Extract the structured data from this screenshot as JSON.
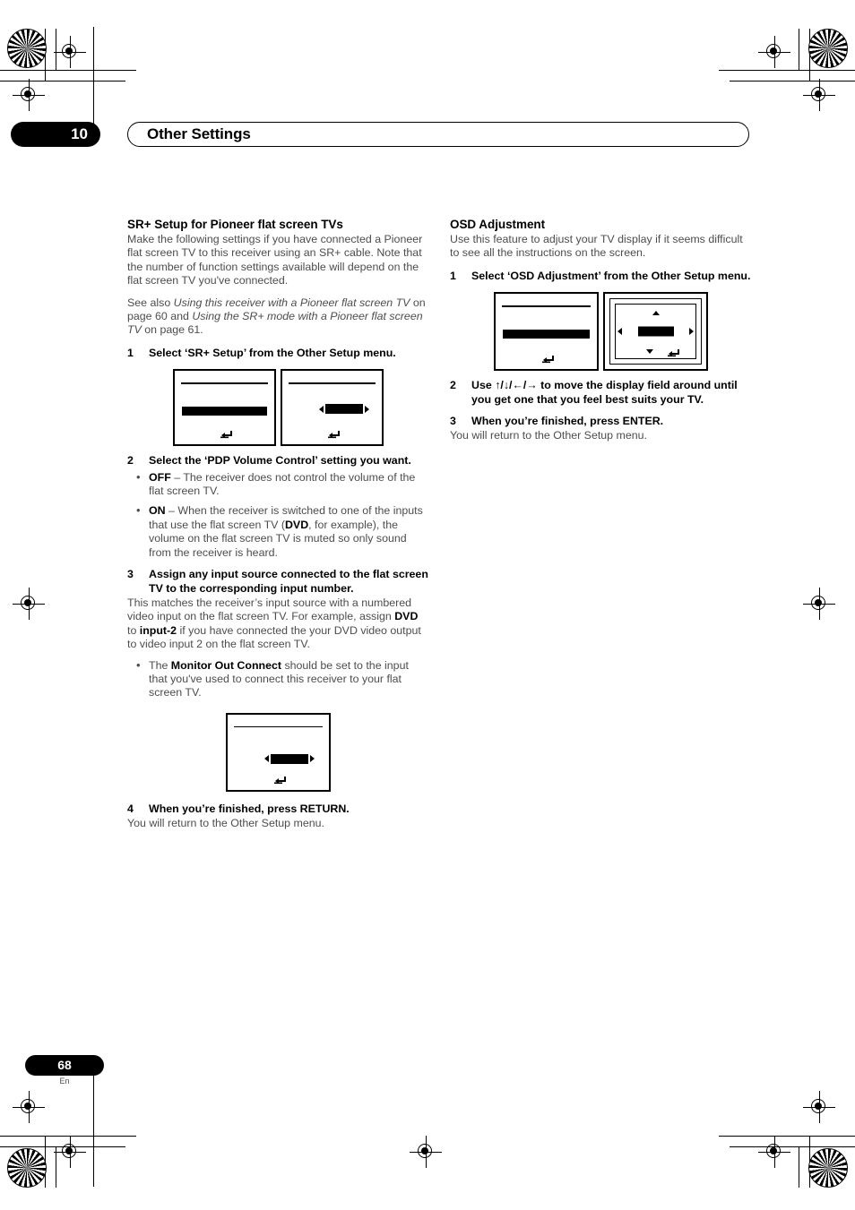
{
  "header": {
    "chapter_number": "10",
    "chapter_title": "Other Settings"
  },
  "left_column": {
    "section_title": "SR+ Setup for Pioneer flat screen TVs",
    "intro_p1": "Make the following settings if you have connected a Pioneer flat screen TV to this receiver using an SR+ cable. Note that the number of function settings available will depend on the flat screen TV you've connected.",
    "intro_p2_prefix": "See also ",
    "intro_p2_italic1": "Using this receiver with a Pioneer flat screen TV",
    "intro_p2_mid": " on page 60 and ",
    "intro_p2_italic2": "Using the SR+ mode with a Pioneer flat screen TV",
    "intro_p2_suffix": " on page 61.",
    "step1_num": "1",
    "step1_text": "Select ‘SR+ Setup’ from the Other Setup menu.",
    "step2_num": "2",
    "step2_text": "Select the ‘PDP Volume Control’ setting you want.",
    "bullet_off_label": "OFF",
    "bullet_off_text": " – The receiver does not control the volume of the flat screen TV.",
    "bullet_on_label": "ON",
    "bullet_on_text_a": " – When the receiver is switched to one of the inputs that use the flat screen TV (",
    "bullet_on_bold_dvd": "DVD",
    "bullet_on_text_b": ", for example), the volume on the flat screen TV is muted so only sound from the receiver is heard.",
    "step3_num": "3",
    "step3_text": "Assign any input source connected to the flat screen TV to the corresponding input number.",
    "step3_body_a": "This matches the receiver’s input source with a numbered video input on the flat screen TV. For example, assign ",
    "step3_bold_dvd": "DVD",
    "step3_body_b": " to ",
    "step3_bold_input2": "input-2",
    "step3_body_c": " if you have connected the your DVD video output to video input 2 on the flat screen TV.",
    "bullet_monitor_a": "The ",
    "bullet_monitor_bold": "Monitor Out Connect",
    "bullet_monitor_b": " should be set to the input that you've used to connect this receiver to your flat screen TV.",
    "step4_num": "4",
    "step4_text": "When you’re finished, press RETURN.",
    "step4_body": "You will return to the Other Setup menu."
  },
  "right_column": {
    "section_title": "OSD Adjustment",
    "intro": "Use this feature to adjust your TV display if it seems difficult to see all the instructions on the screen.",
    "step1_num": "1",
    "step1_text": "Select ‘OSD Adjustment’ from the Other Setup menu.",
    "step2_num": "2",
    "step2_text_a": "Use ",
    "step2_arrows": "↑/↓/←/→",
    "step2_text_b": " to move the display field around until you get one that you feel best suits your TV.",
    "step3_num": "3",
    "step3_text": "When you’re finished, press ENTER.",
    "step3_body": "You will return to the Other Setup menu."
  },
  "footer": {
    "page_number": "68",
    "language_code": "En"
  },
  "osd_icons": {
    "return_icon": "return-arrow-icon",
    "left_arrow": "left-triangle-icon",
    "right_arrow": "right-triangle-icon",
    "up_arrow": "up-triangle-icon",
    "down_arrow": "down-triangle-icon"
  },
  "colors": {
    "ink": "#000000",
    "body_text": "#4d4d4f",
    "paper": "#ffffff"
  }
}
